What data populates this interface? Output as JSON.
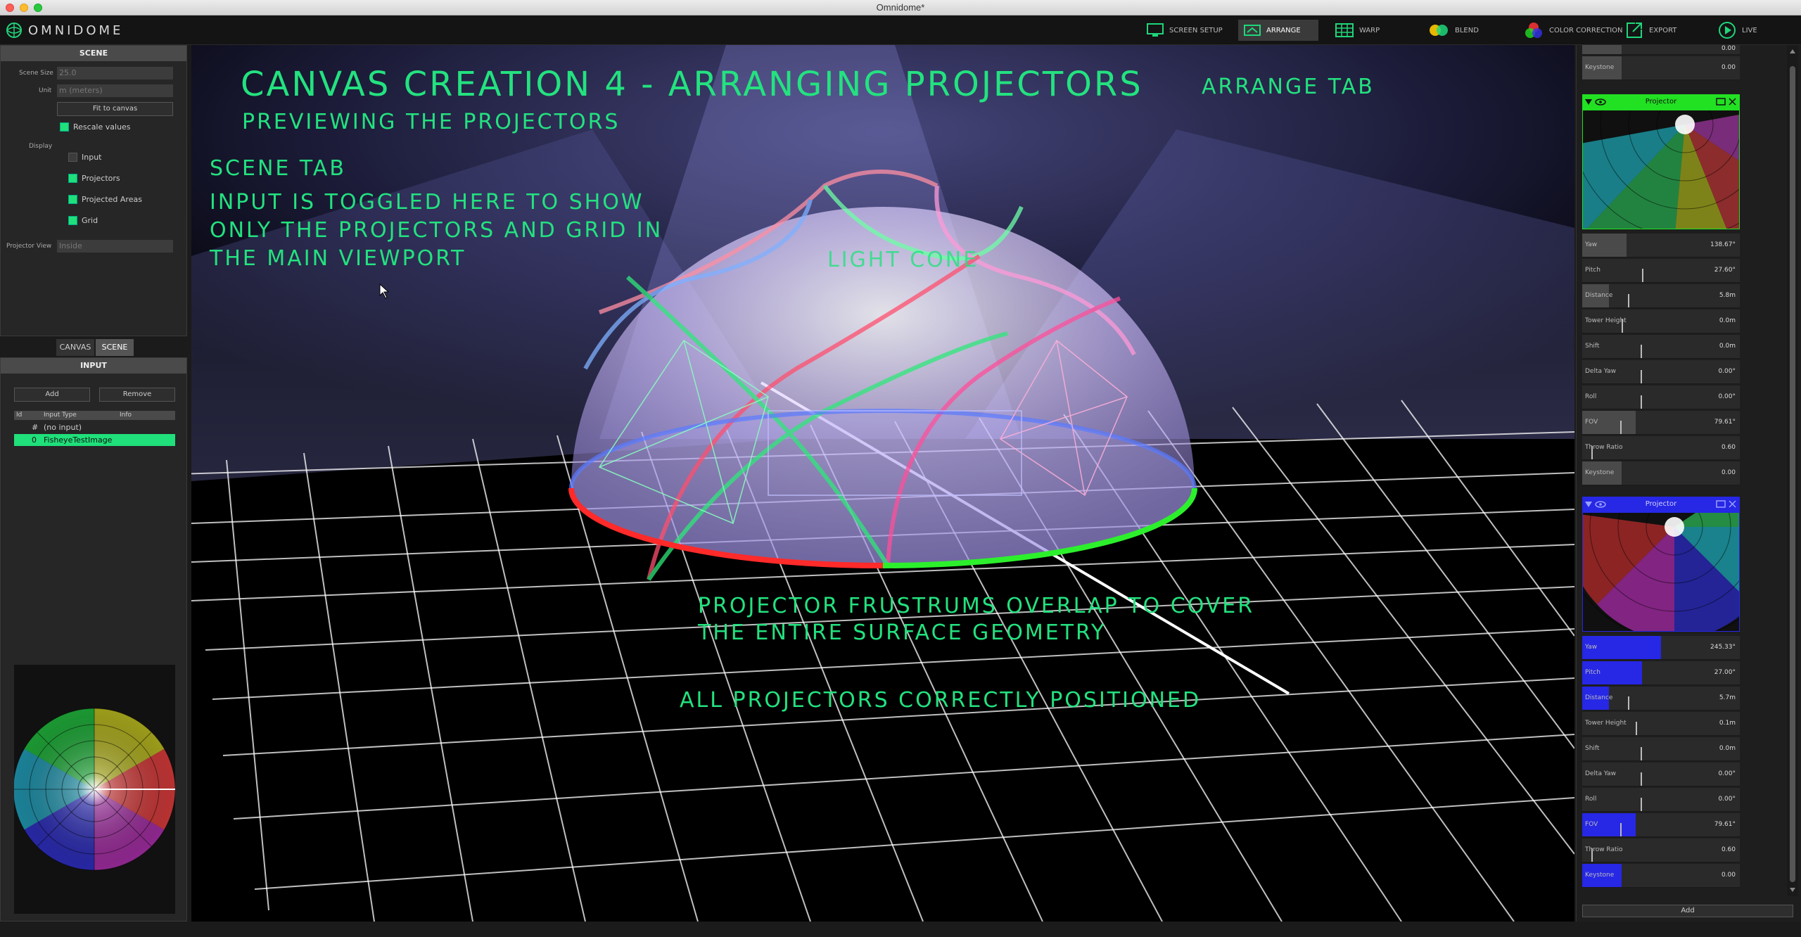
{
  "window": {
    "title": "Omnidome*"
  },
  "app": {
    "logo_text": "OMNIDOME"
  },
  "tabs": [
    {
      "label": "SCREEN SETUP",
      "icon": "monitor-icon"
    },
    {
      "label": "ARRANGE",
      "icon": "arrange-icon"
    },
    {
      "label": "WARP",
      "icon": "grid-icon"
    },
    {
      "label": "BLEND",
      "icon": "blend-icon"
    },
    {
      "label": "COLOR CORRECTION",
      "icon": "color-icon"
    },
    {
      "label": "EXPORT",
      "icon": "export-icon"
    },
    {
      "label": "LIVE",
      "icon": "play-icon"
    }
  ],
  "scene_panel": {
    "title": "SCENE",
    "scene_size_label": "Scene Size",
    "scene_size_value": "25.0",
    "unit_label": "Unit",
    "unit_value": "m (meters)",
    "fit_button": "Fit to canvas",
    "rescale_label": "Rescale values",
    "display_label": "Display",
    "display_items": [
      {
        "label": "Input",
        "checked": false
      },
      {
        "label": "Projectors",
        "checked": true
      },
      {
        "label": "Projected Areas",
        "checked": true
      },
      {
        "label": "Grid",
        "checked": true
      }
    ],
    "projector_view_label": "Projector View",
    "projector_view_value": "Inside"
  },
  "subtabs": [
    "CANVAS",
    "SCENE"
  ],
  "input_panel": {
    "title": "INPUT",
    "add_button": "Add",
    "remove_button": "Remove",
    "columns": [
      "Id",
      "Input Type",
      "Info"
    ],
    "rows": [
      {
        "id": "#",
        "type": "(no input)",
        "selected": false
      },
      {
        "id": "0",
        "type": "FisheyeTestImage",
        "selected": true
      }
    ]
  },
  "annotations": {
    "main_title": "CANVAS CREATION 4 - ARRANGING PROJECTORS",
    "subtitle": "PREVIEWING THE PROJECTORS",
    "arrange_tab": "ARRANGE TAB",
    "scene_tab": "SCENE TAB",
    "input_note_1": "INPUT IS TOGGLED HERE TO SHOW",
    "input_note_2": "ONLY THE PROJECTORS AND GRID IN",
    "input_note_3": "THE MAIN VIEWPORT",
    "light_cone": "LIGHT CONE",
    "frustrum_1": "PROJECTOR FRUSTRUMS OVERLAP TO COVER",
    "frustrum_2": "THE ENTIRE SURFACE GEOMETRY",
    "positioned": "ALL PROJECTORS CORRECTLY POSITIONED"
  },
  "projector_top_partial": [
    {
      "name": "",
      "value": "0.00"
    },
    {
      "name": "Keystone",
      "value": "0.00"
    }
  ],
  "projectors": [
    {
      "header": "Projector",
      "color": "#22e022",
      "params": [
        {
          "name": "Yaw",
          "value": "138.67°",
          "fill": 0.28
        },
        {
          "name": "Pitch",
          "value": "27.60°",
          "fill": 0.0,
          "tick": 0.38
        },
        {
          "name": "Distance",
          "value": "5.8m",
          "fill": 0.17,
          "tick": 0.29
        },
        {
          "name": "Tower Height",
          "value": "0.0m",
          "fill": 0.0,
          "tick": 0.25
        },
        {
          "name": "Shift",
          "value": "0.0m",
          "fill": 0.0,
          "tick": 0.37
        },
        {
          "name": "Delta Yaw",
          "value": "0.00°",
          "fill": 0.0,
          "tick": 0.37
        },
        {
          "name": "Roll",
          "value": "0.00°",
          "fill": 0.0,
          "tick": 0.37
        },
        {
          "name": "FOV",
          "value": "79.61°",
          "fill": 0.34,
          "tick": 0.24
        },
        {
          "name": "Throw Ratio",
          "value": "0.60",
          "fill": 0.0,
          "tick": 0.06
        },
        {
          "name": "Keystone",
          "value": "0.00",
          "fill": 0.25
        }
      ]
    },
    {
      "header": "Projector",
      "color": "#2727e6",
      "params": [
        {
          "name": "Yaw",
          "value": "245.33°",
          "fill": 0.5
        },
        {
          "name": "Pitch",
          "value": "27.00°",
          "fill": 0.38
        },
        {
          "name": "Distance",
          "value": "5.7m",
          "fill": 0.17,
          "tick": 0.29
        },
        {
          "name": "Tower Height",
          "value": "0.1m",
          "fill": 0.0,
          "tick": 0.34
        },
        {
          "name": "Shift",
          "value": "0.0m",
          "fill": 0.0,
          "tick": 0.37
        },
        {
          "name": "Delta Yaw",
          "value": "0.00°",
          "fill": 0.0,
          "tick": 0.37
        },
        {
          "name": "Roll",
          "value": "0.00°",
          "fill": 0.0,
          "tick": 0.37
        },
        {
          "name": "FOV",
          "value": "79.61°",
          "fill": 0.34,
          "tick": 0.24
        },
        {
          "name": "Throw Ratio",
          "value": "0.60",
          "fill": 0.0,
          "tick": 0.06
        },
        {
          "name": "Keystone",
          "value": "0.00",
          "fill": 0.25
        }
      ]
    }
  ],
  "right_add_button": "Add"
}
